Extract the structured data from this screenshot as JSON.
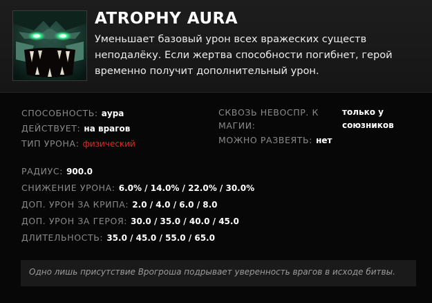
{
  "ability": {
    "name": "ATROPHY AURA",
    "description": "Уменьшает базовый урон всех вражеских существ неподалёку. Если жертва способности погибнет, герой временно получит дополнительный урон.",
    "icon": "undying-ghoul-face-icon"
  },
  "attributes_left": [
    {
      "label": "СПОСОБНОСТЬ:",
      "value": "аура"
    },
    {
      "label": "ДЕЙСТВУЕТ:",
      "value": "на врагов"
    },
    {
      "label": "ТИП УРОНА:",
      "value": "физический",
      "value_color": "#e8261f"
    }
  ],
  "attributes_right": [
    {
      "label_line1": "СКВОЗЬ НЕВОСПР. К",
      "label_line2": "МАГИИ:",
      "value_line1": "только у",
      "value_line2": "союзников"
    },
    {
      "label": "МОЖНО РАЗВЕЯТЬ:",
      "value": "нет"
    }
  ],
  "stats": [
    {
      "label": "РАДИУС:",
      "value": "900.0"
    },
    {
      "label": "СНИЖЕНИЕ УРОНА:",
      "value": "6.0% / 14.0% / 22.0% / 30.0%"
    },
    {
      "label": "ДОП. УРОН ЗА КРИПА:",
      "value": "2.0 / 4.0 / 6.0 / 8.0"
    },
    {
      "label": "ДОП. УРОН ЗА ГЕРОЯ:",
      "value": "30.0 / 35.0 / 40.0 / 45.0"
    },
    {
      "label": "ДЛИТЕЛЬНОСТЬ:",
      "value": "35.0 / 45.0 / 55.0 / 65.0"
    }
  ],
  "lore": "Одно лишь присутствие Врогроша подрывает уверенность врагов в исходе битвы."
}
